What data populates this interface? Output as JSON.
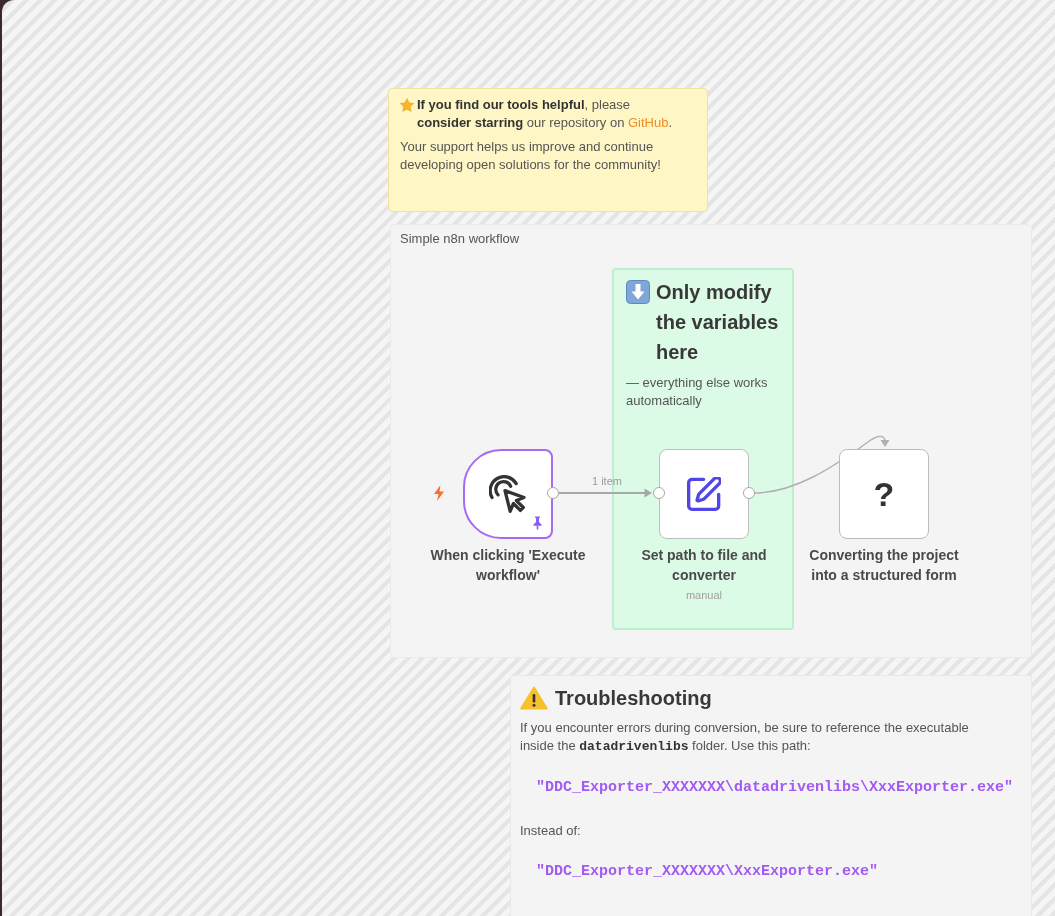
{
  "canvas": {
    "sticky_notes": [
      {
        "kind": "support",
        "color": "#fff6c6",
        "blocks": [
          {
            "kind": "lead",
            "before": "**If you find our tools helpful**, please **consider starring** our repository on ",
            "link": "GitHub",
            "after": "."
          },
          {
            "kind": "paragraph",
            "text": "Your support helps us improve and continue developing open solutions for the community!"
          }
        ]
      },
      {
        "kind": "group",
        "color": "#f4f4f4",
        "blocks": [
          {
            "kind": "caption",
            "text": "Simple n8n workflow"
          }
        ]
      },
      {
        "kind": "highlight",
        "color": "#dcfbe6",
        "blocks": [
          {
            "kind": "heading",
            "text": "Only modify the variables here"
          },
          {
            "kind": "paragraph",
            "text": "— everything else works automatically"
          }
        ]
      },
      {
        "kind": "troubleshooting",
        "color": "#f4f4f4",
        "blocks": [
          {
            "kind": "heading",
            "text": "Troubleshooting"
          },
          {
            "kind": "paragraph",
            "text": "If you encounter errors during conversion, be sure to reference the executable inside the **datadrivenlibs** folder. Use this path:"
          },
          {
            "kind": "code",
            "text": "\"DDC_Exporter_XXXXXXX\\datadrivenlibs\\XxxExporter.exe\""
          },
          {
            "kind": "paragraph",
            "text": "Instead of:"
          },
          {
            "kind": "code",
            "text": "\"DDC_Exporter_XXXXXXX\\XxxExporter.exe\""
          }
        ]
      }
    ],
    "nodes": [
      {
        "kind": "trigger",
        "name": "When clicking 'Execute workflow'",
        "pinned": true
      },
      {
        "kind": "set",
        "name": "Set path to file and converter",
        "subtitle": "manual",
        "pinned": false
      },
      {
        "kind": "unknown",
        "symbol": "?",
        "name": "Converting the project into a structured form",
        "pinned": false
      }
    ],
    "connections": [
      {
        "kind": "straight",
        "label": "1 item"
      },
      {
        "kind": "curved"
      }
    ]
  }
}
